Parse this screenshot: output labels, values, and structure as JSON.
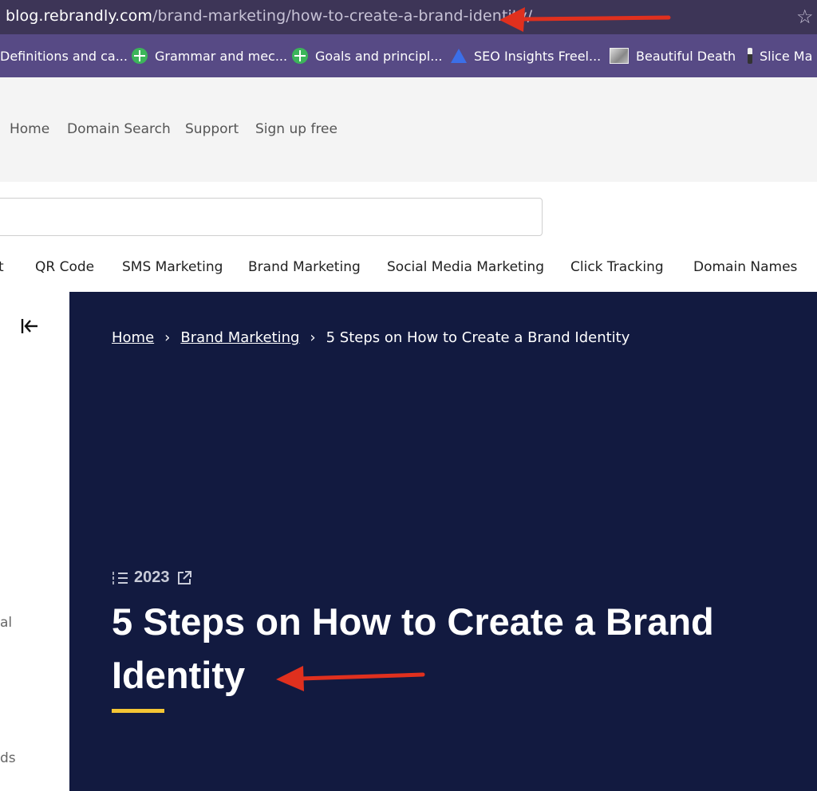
{
  "browser": {
    "url_domain": "blog.rebrandly.com",
    "url_path": "/brand-marketing/how-to-create-a-brand-identity/",
    "star_icon": "star-icon",
    "bookmarks": [
      {
        "label": "Definitions and ca...",
        "icon": "none"
      },
      {
        "label": "Grammar and mec...",
        "icon": "green-plus-icon"
      },
      {
        "label": "Goals and principl...",
        "icon": "green-plus-icon"
      },
      {
        "label": "SEO Insights Freel...",
        "icon": "blue-triangle-icon"
      },
      {
        "label": "Beautiful Death",
        "icon": "image-thumb-icon"
      },
      {
        "label": "Slice Ma",
        "icon": "pen-icon"
      }
    ]
  },
  "header": {
    "nav": [
      "Home",
      "Domain Search",
      "Support",
      "Sign up free"
    ]
  },
  "search": {
    "placeholder": ""
  },
  "categories": [
    "t",
    "QR Code",
    "SMS Marketing",
    "Brand Marketing",
    "Social Media Marketing",
    "Click Tracking",
    "Domain Names"
  ],
  "sidebar": {
    "collapse_icon": "collapse-left-icon",
    "fragments": [
      "al",
      "ds"
    ]
  },
  "hero": {
    "breadcrumb": [
      "Home",
      "Brand Marketing",
      "5 Steps on How to Create a Brand Identity"
    ],
    "breadcrumb_separator": "›",
    "meta_label": "2023",
    "title": "5 Steps on How to Create a Brand Identity",
    "accent_color": "#f4c534",
    "background_color": "#121a40"
  },
  "annotations": {
    "arrow_color": "#e0301e"
  }
}
